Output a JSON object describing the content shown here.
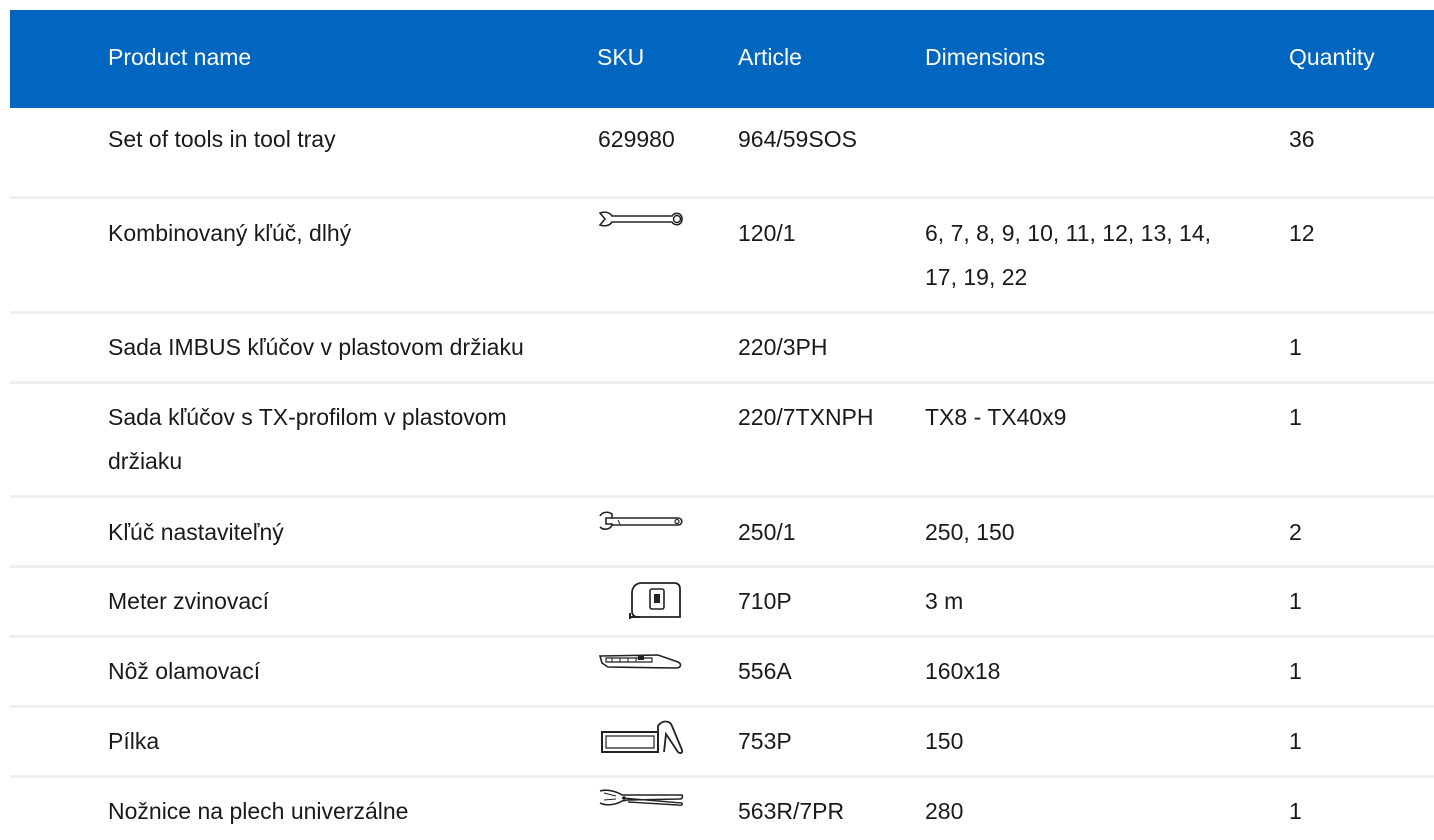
{
  "header": {
    "product_name": "Product name",
    "sku": "SKU",
    "article": "Article",
    "dimensions": "Dimensions",
    "quantity": "Quantity"
  },
  "colors": {
    "header_bg": "#0066bf",
    "header_text": "#ffffff",
    "row_divider": "#eeeeee"
  },
  "rows": [
    {
      "name": "Set of tools in tool tray",
      "sku": "629980",
      "icon": "",
      "article": "964/59SOS",
      "dimensions": "",
      "quantity": "36"
    },
    {
      "name": "Kombinovaný kľúč, dlhý",
      "sku": "",
      "icon": "combination-wrench-icon",
      "article": "120/1",
      "dimensions": "6, 7, 8, 9, 10, 11, 12, 13, 14, 17, 19, 22",
      "quantity": "12"
    },
    {
      "name": "Sada IMBUS kľúčov v plastovom držiaku",
      "sku": "",
      "icon": "",
      "article": "220/3PH",
      "dimensions": "",
      "quantity": "1"
    },
    {
      "name": "Sada kľúčov s TX-profilom v plastovom držiaku",
      "sku": "",
      "icon": "",
      "article": "220/7TXNPH",
      "dimensions": "TX8 - TX40x9",
      "quantity": "1"
    },
    {
      "name": "Kľúč nastaviteľný",
      "sku": "",
      "icon": "adjustable-wrench-icon",
      "article": "250/1",
      "dimensions": "250, 150",
      "quantity": "2"
    },
    {
      "name": "Meter zvinovací",
      "sku": "",
      "icon": "tape-measure-icon",
      "article": "710P",
      "dimensions": "3 m",
      "quantity": "1"
    },
    {
      "name": "Nôž olamovací",
      "sku": "",
      "icon": "utility-knife-icon",
      "article": "556A",
      "dimensions": "160x18",
      "quantity": "1"
    },
    {
      "name": "Pílka",
      "sku": "",
      "icon": "hacksaw-icon",
      "article": "753P",
      "dimensions": "150",
      "quantity": "1"
    },
    {
      "name": "Nožnice na plech univerzálne",
      "sku": "",
      "icon": "tin-snips-icon",
      "article": "563R/7PR",
      "dimensions": "280",
      "quantity": "1"
    }
  ]
}
